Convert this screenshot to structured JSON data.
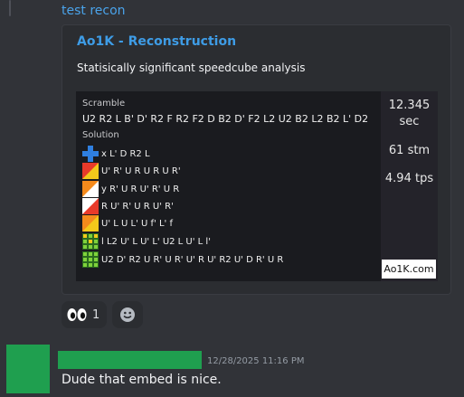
{
  "message_top": {
    "link_text": "test recon"
  },
  "embed": {
    "title": "Ao1K - Reconstruction",
    "description": "Statisically significant speedcube analysis",
    "image": {
      "scramble_label": "Scramble",
      "scramble": "U2 R2 L B' D' R2 F R2 F2 D B2 D' F2 L2 U2 B2 L2 B2 L' D2",
      "solution_label": "Solution",
      "solution_steps": [
        {
          "icon": "cross-icon",
          "moves": "x L' D R2 L"
        },
        {
          "icon": "f2l-icon",
          "moves": "U' R' U R U R U R'"
        },
        {
          "icon": "f2l-icon",
          "moves": "y R' U R U' R' U R"
        },
        {
          "icon": "f2l-icon",
          "moves": "R U' R' U R U' R'"
        },
        {
          "icon": "f2l-icon",
          "moves": "U' L U L' U f' L' f"
        },
        {
          "icon": "oll-icon",
          "moves": "l L2 U' L U' L' U2 L U' L l'"
        },
        {
          "icon": "pll-icon",
          "moves": "U2 D' R2 U R' U R' U' R U' R2 U' D R' U R"
        }
      ],
      "time": "12.345",
      "time_unit": "sec",
      "moves": "61 stm",
      "tps": "4.94 tps",
      "brand": "Ao1K.com"
    }
  },
  "reactions": [
    {
      "icon": "eyes-emoji-icon",
      "count": "1"
    },
    {
      "icon": "add-reaction-icon"
    }
  ],
  "reply": {
    "timestamp": "12/28/2025 11:16 PM",
    "text": "Dude that embed is nice."
  },
  "colors": {
    "accent": "#3e9ce6",
    "avatar": "#1f9f4f",
    "background": "#313338"
  }
}
